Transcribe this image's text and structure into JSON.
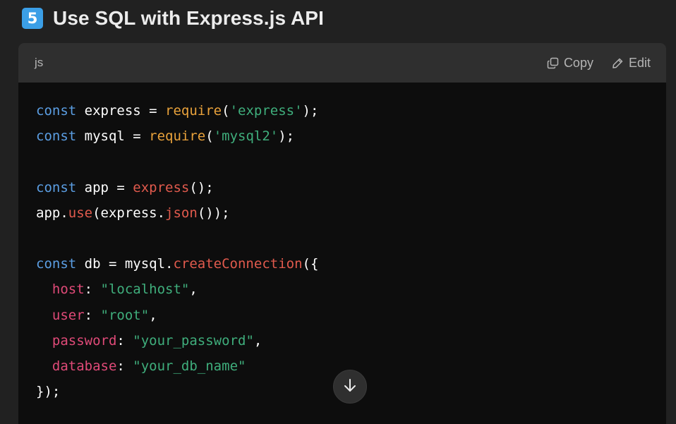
{
  "heading": {
    "step_number": "5",
    "title": "Use SQL with Express.js API"
  },
  "code_block": {
    "language": "js",
    "copy_label": "Copy",
    "edit_label": "Edit",
    "lines": [
      [
        {
          "t": "const",
          "c": "kw"
        },
        {
          "t": " express = ",
          "c": "pl"
        },
        {
          "t": "require",
          "c": "fn"
        },
        {
          "t": "(",
          "c": "pl"
        },
        {
          "t": "'express'",
          "c": "str"
        },
        {
          "t": ");",
          "c": "pl"
        }
      ],
      [
        {
          "t": "const",
          "c": "kw"
        },
        {
          "t": " mysql = ",
          "c": "pl"
        },
        {
          "t": "require",
          "c": "fn"
        },
        {
          "t": "(",
          "c": "pl"
        },
        {
          "t": "'mysql2'",
          "c": "str"
        },
        {
          "t": ");",
          "c": "pl"
        }
      ],
      [],
      [
        {
          "t": "const",
          "c": "kw"
        },
        {
          "t": " app = ",
          "c": "pl"
        },
        {
          "t": "express",
          "c": "call"
        },
        {
          "t": "();",
          "c": "pl"
        }
      ],
      [
        {
          "t": "app.",
          "c": "pl"
        },
        {
          "t": "use",
          "c": "call"
        },
        {
          "t": "(express.",
          "c": "pl"
        },
        {
          "t": "json",
          "c": "call"
        },
        {
          "t": "());",
          "c": "pl"
        }
      ],
      [],
      [
        {
          "t": "const",
          "c": "kw"
        },
        {
          "t": " db = mysql.",
          "c": "pl"
        },
        {
          "t": "createConnection",
          "c": "call"
        },
        {
          "t": "({",
          "c": "pl"
        }
      ],
      [
        {
          "t": "  ",
          "c": "pl"
        },
        {
          "t": "host",
          "c": "prop"
        },
        {
          "t": ": ",
          "c": "pl"
        },
        {
          "t": "\"localhost\"",
          "c": "str"
        },
        {
          "t": ",",
          "c": "pl"
        }
      ],
      [
        {
          "t": "  ",
          "c": "pl"
        },
        {
          "t": "user",
          "c": "prop"
        },
        {
          "t": ": ",
          "c": "pl"
        },
        {
          "t": "\"root\"",
          "c": "str"
        },
        {
          "t": ",",
          "c": "pl"
        }
      ],
      [
        {
          "t": "  ",
          "c": "pl"
        },
        {
          "t": "password",
          "c": "prop"
        },
        {
          "t": ": ",
          "c": "pl"
        },
        {
          "t": "\"your_password\"",
          "c": "str"
        },
        {
          "t": ",",
          "c": "pl"
        }
      ],
      [
        {
          "t": "  ",
          "c": "pl"
        },
        {
          "t": "database",
          "c": "prop"
        },
        {
          "t": ": ",
          "c": "pl"
        },
        {
          "t": "\"your_db_name\"",
          "c": "str"
        }
      ],
      [
        {
          "t": "});",
          "c": "pl"
        }
      ]
    ]
  },
  "icons": {
    "copy": "copy-icon",
    "edit": "pencil-icon",
    "scroll": "arrow-down-icon"
  },
  "colors": {
    "step_badge": "#3b9fe7",
    "keyword": "#5b9ee3",
    "function": "#e9a23b",
    "string": "#3fae7c",
    "call": "#e15a4d",
    "property": "#e04a78"
  }
}
